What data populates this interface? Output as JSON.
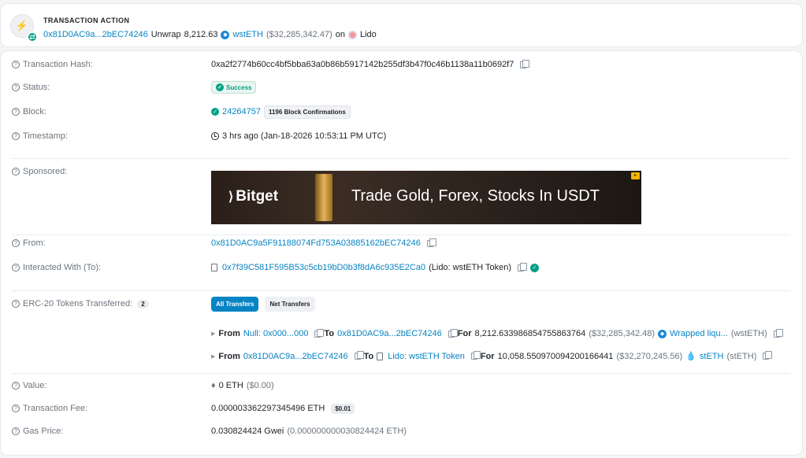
{
  "action": {
    "title": "TRANSACTION ACTION",
    "from_address": "0x81D0AC9a...2bEC74246",
    "verb": "Unwrap",
    "amount": "8,212.63",
    "token": "wstETH",
    "usd": "($32,285,342.47)",
    "on": "on",
    "protocol": "Lido"
  },
  "details": {
    "tx_hash": {
      "label": "Transaction Hash:",
      "value": "0xa2f2774b60cc4bf5bba63a0b86b5917142b255df3b47f0c46b1138a11b0692f7"
    },
    "status": {
      "label": "Status:",
      "value": "Success"
    },
    "block": {
      "label": "Block:",
      "value": "24264757",
      "confirmations": "1196 Block Confirmations"
    },
    "timestamp": {
      "label": "Timestamp:",
      "value": "3 hrs ago (Jan-18-2026 10:53:11 PM UTC)"
    },
    "sponsored": {
      "label": "Sponsored:",
      "ad_brand": "Bitget",
      "ad_text": "Trade Gold, Forex, Stocks In USDT"
    },
    "from": {
      "label": "From:",
      "value": "0x81D0AC9a5F91188074Fd753A03885162bEC74246"
    },
    "interacted": {
      "label": "Interacted With (To):",
      "value": "0x7f39C581F595B53c5cb19bD0b3f8dA6c935E2Ca0",
      "name": "(Lido: wstETH Token)"
    },
    "erc20": {
      "label": "ERC-20 Tokens Transferred:",
      "count": "2",
      "tab_all": "All Transfers",
      "tab_net": "Net Transfers",
      "transfers": [
        {
          "from_label": "From",
          "from": "Null: 0x000...000",
          "to_label": "To",
          "to": "0x81D0AC9a...2bEC74246",
          "for_label": "For",
          "amount": "8,212.633986854755863764",
          "usd": "($32,285,342.48)",
          "token": "Wrapped liqu...",
          "symbol": "(wstETH)"
        },
        {
          "from_label": "From",
          "from": "0x81D0AC9a...2bEC74246",
          "to_label": "To",
          "to": "Lido: wstETH Token",
          "for_label": "For",
          "amount": "10,058.550970094200166441",
          "usd": "($32,270,245.56)",
          "token": "stETH",
          "symbol": "(stETH)"
        }
      ]
    },
    "value": {
      "label": "Value:",
      "amount": "0 ETH",
      "usd": "($0.00)"
    },
    "fee": {
      "label": "Transaction Fee:",
      "amount": "0.000003362297345496 ETH",
      "usd": "$0.01"
    },
    "gas": {
      "label": "Gas Price:",
      "amount": "0.030824424 Gwei",
      "eth": "(0.000000000030824424 ETH)"
    }
  }
}
